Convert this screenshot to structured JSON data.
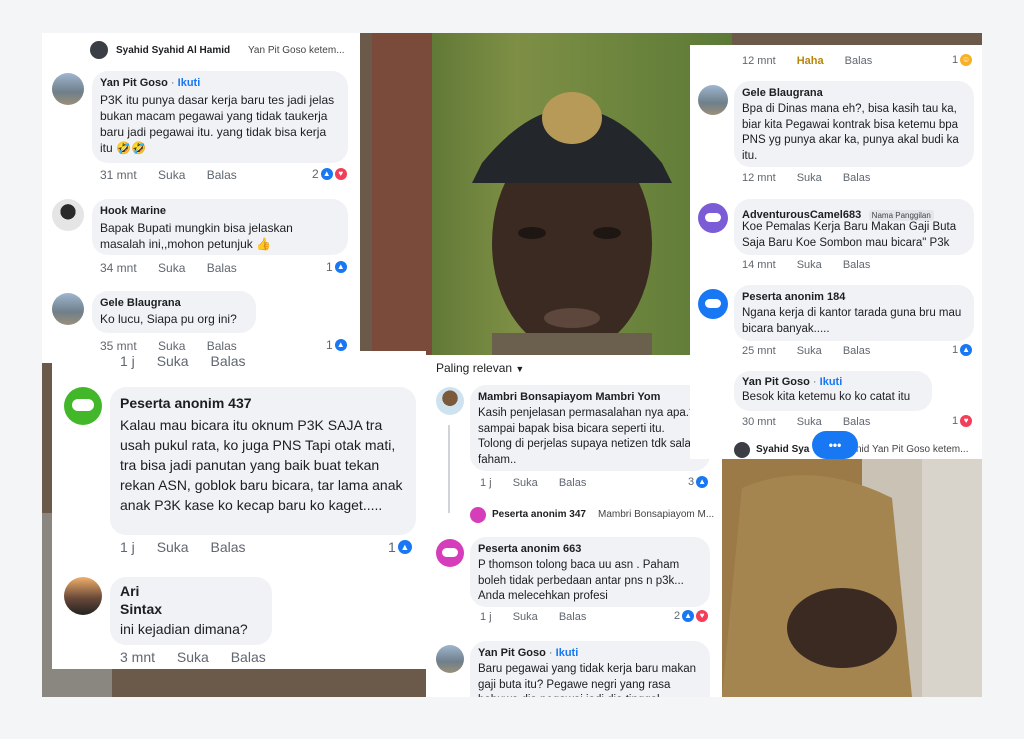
{
  "left_panel": {
    "header": {
      "name": "Syahid Syahid Al Hamid",
      "reply_to": "Yan Pit Goso ketem..."
    },
    "comments": [
      {
        "name": "Yan Pit Goso",
        "follow": "Ikuti",
        "text": "P3K itu punya dasar kerja baru tes jadi jelas bukan macam pegawai yang tidak taukerja baru jadi pegawai itu. yang tidak bisa kerja itu 🤣🤣",
        "time": "31 mnt",
        "like": "Suka",
        "reply": "Balas",
        "count": "2"
      },
      {
        "name": "Hook Marine",
        "text": "Bapak Bupati mungkin bisa jelaskan masalah ini,,mohon petunjuk 👍",
        "time": "34 mnt",
        "like": "Suka",
        "reply": "Balas",
        "count": "1"
      },
      {
        "name": "Gele Blaugrana",
        "text": "Ko lucu, Siapa pu org ini?",
        "time": "35 mnt",
        "like": "Suka",
        "reply": "Balas",
        "count": "1"
      }
    ]
  },
  "big_panel": {
    "top_meta": {
      "time": "1 j",
      "like": "Suka",
      "reply": "Balas"
    },
    "comments": [
      {
        "name": "Peserta anonim 437",
        "text": "Kalau mau bicara itu oknum P3K SAJA tra usah pukul rata, ko juga PNS Tapi otak mati, tra bisa jadi panutan yang baik buat tekan rekan ASN, goblok baru bicara, tar lama anak anak P3K kase ko kecap baru ko kaget.....",
        "time": "1 j",
        "like": "Suka",
        "reply": "Balas",
        "count": "1"
      },
      {
        "name": "Ari Sintax",
        "name_line1": "Ari",
        "name_line2": "Sintax",
        "text": "ini kejadian dimana?",
        "time": "3 mnt",
        "like": "Suka",
        "reply": "Balas"
      }
    ]
  },
  "middle_panel": {
    "sort_label": "Paling relevan",
    "comments": [
      {
        "name": "Mambri Bonsapiayom Mambri Yom",
        "text": "Kasih penjelasan permasalahan nya apa.? sampai bapak bisa bicara seperti itu. Tolong di perjelas supaya netizen tdk salah faham..",
        "time": "1 j",
        "like": "Suka",
        "reply": "Balas",
        "count": "3"
      },
      {
        "name": "Peserta anonim 347",
        "reply_to": "Mambri Bonsapiayom M..."
      },
      {
        "name": "Peserta anonim 663",
        "text": "P thomson tolong baca uu asn . Paham boleh tidak perbedaan antar pns n p3k... Anda melecehkan profesi",
        "time": "1 j",
        "like": "Suka",
        "reply": "Balas",
        "count": "2"
      },
      {
        "name": "Yan Pit Goso",
        "follow": "Ikuti",
        "text": "Baru pegawai yang tidak kerja baru makan gaji buta itu? Pegawe negri yang rasa bahuwa dia pegawai jadi dia tinggal"
      }
    ]
  },
  "right_panel": {
    "top_meta": {
      "time": "12 mnt",
      "reaction_label": "Haha",
      "reply": "Balas",
      "count": "1"
    },
    "comments": [
      {
        "name": "Gele Blaugrana",
        "text": "Bpa di Dinas mana eh?, bisa kasih tau ka, biar kita Pegawai kontrak bisa ketemu bpa PNS yg punya akar ka, punya akal budi ka itu.",
        "time": "12 mnt",
        "like": "Suka",
        "reply": "Balas"
      },
      {
        "name": "AdventurousCamel683",
        "badge": "Nama Panggilan",
        "text": "Koe Pemalas Kerja Baru Makan Gaji Buta Saja Baru Koe Sombon mau bicara\" P3k",
        "time": "14 mnt",
        "like": "Suka",
        "reply": "Balas"
      },
      {
        "name": "Peserta anonim 184",
        "text": "Ngana kerja di kantor tarada guna bru mau bicara banyak.....",
        "time": "25 mnt",
        "like": "Suka",
        "reply": "Balas",
        "count": "1"
      },
      {
        "name": "Yan Pit Goso",
        "follow": "Ikuti",
        "text": "Besok kita ketemu ko  ko catat itu",
        "time": "30 mnt",
        "like": "Suka",
        "reply": "Balas",
        "count": "1"
      }
    ],
    "footer": {
      "name": "Syahid Syahid Al Hamid",
      "name_visible": "Syahid Sya",
      "reply_to_visible": "nid Yan Pit Goso ketem...",
      "more": "•••"
    }
  },
  "icons": {
    "like": "thumbs-up-icon",
    "love": "heart-icon",
    "haha": "laugh-icon",
    "anon": "incognito-icon"
  },
  "colors": {
    "link": "#1877f2",
    "anon_green": "#42b72a",
    "anon_purple": "#7b5cd6",
    "anon_blue": "#1877f2",
    "anon_magenta": "#d63dbb"
  }
}
